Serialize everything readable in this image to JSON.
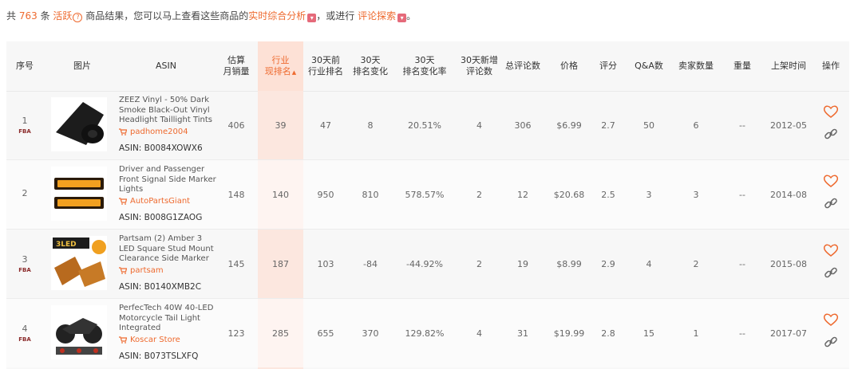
{
  "summary": {
    "prefix": "共",
    "count": "763",
    "unit": "条",
    "active": "活跃",
    "active_q": "?",
    "middle": "商品结果，您可以马上查看这些商品的",
    "link1": "实时综合分析",
    "mid2": "，或进行",
    "link2": "评论探索",
    "end": "。"
  },
  "headers": {
    "index": "序号",
    "image": "图片",
    "asin": "ASIN",
    "est_sales_1": "估算",
    "est_sales_2": "月销量",
    "industry_rank_1": "行业",
    "industry_rank_2": "现排名",
    "rank30_1": "30天前",
    "rank30_2": "行业排名",
    "change30_1": "30天",
    "change30_2": "排名变化",
    "changerate_1": "30天",
    "changerate_2": "排名变化率",
    "newreviews_1": "30天新增",
    "newreviews_2": "评论数",
    "total_reviews": "总评论数",
    "price": "价格",
    "rating": "评分",
    "qa": "Q&A数",
    "sellers": "卖家数量",
    "weight": "重量",
    "listed": "上架时间",
    "ops": "操作"
  },
  "rows": [
    {
      "index": "1",
      "fba": "FBA",
      "title": "ZEEZ Vinyl - 50% Dark Smoke Black-Out Vinyl Headlight Taillight Tints",
      "seller": "padhome2004",
      "asin": "ASIN:  B0084XOWX6",
      "sales": "406",
      "rank": "39",
      "rank30": "47",
      "change": "8",
      "rate": "20.51%",
      "new_reviews": "4",
      "total_reviews": "306",
      "price": "$6.99",
      "rating": "2.7",
      "qa": "50",
      "sellers": "6",
      "weight": "--",
      "listed": "2012-05"
    },
    {
      "index": "2",
      "fba": "",
      "title": "Driver and Passenger Front Signal Side Marker Lights",
      "seller": "AutoPartsGiant",
      "asin": "ASIN:  B008G1ZAOG",
      "sales": "148",
      "rank": "140",
      "rank30": "950",
      "change": "810",
      "rate": "578.57%",
      "new_reviews": "2",
      "total_reviews": "12",
      "price": "$20.68",
      "rating": "2.5",
      "qa": "3",
      "sellers": "3",
      "weight": "--",
      "listed": "2014-08"
    },
    {
      "index": "3",
      "fba": "FBA",
      "title": "Partsam (2) Amber 3 LED Square Stud Mount Clearance Side Marker",
      "seller": "partsam",
      "asin": "ASIN:  B0140XMB2C",
      "sales": "145",
      "rank": "187",
      "rank30": "103",
      "change": "-84",
      "rate": "-44.92%",
      "new_reviews": "2",
      "total_reviews": "19",
      "price": "$8.99",
      "rating": "2.9",
      "qa": "4",
      "sellers": "2",
      "weight": "--",
      "listed": "2015-08"
    },
    {
      "index": "4",
      "fba": "FBA",
      "title": "PerfecTech 40W 40-LED Motorcycle Tail Light Integrated",
      "seller": "Koscar Store",
      "asin": "ASIN:  B073TSLXFQ",
      "sales": "123",
      "rank": "285",
      "rank30": "655",
      "change": "370",
      "rate": "129.82%",
      "new_reviews": "4",
      "total_reviews": "31",
      "price": "$19.99",
      "rating": "2.8",
      "qa": "15",
      "sellers": "1",
      "weight": "--",
      "listed": "2017-07"
    }
  ],
  "colors": {
    "accent": "#ee6a2f",
    "highlight_column": "#fce7df",
    "fba": "#8b2a2a"
  },
  "icons": [
    "cart-icon",
    "heart-icon",
    "link-icon",
    "sort-icon",
    "help-icon"
  ]
}
